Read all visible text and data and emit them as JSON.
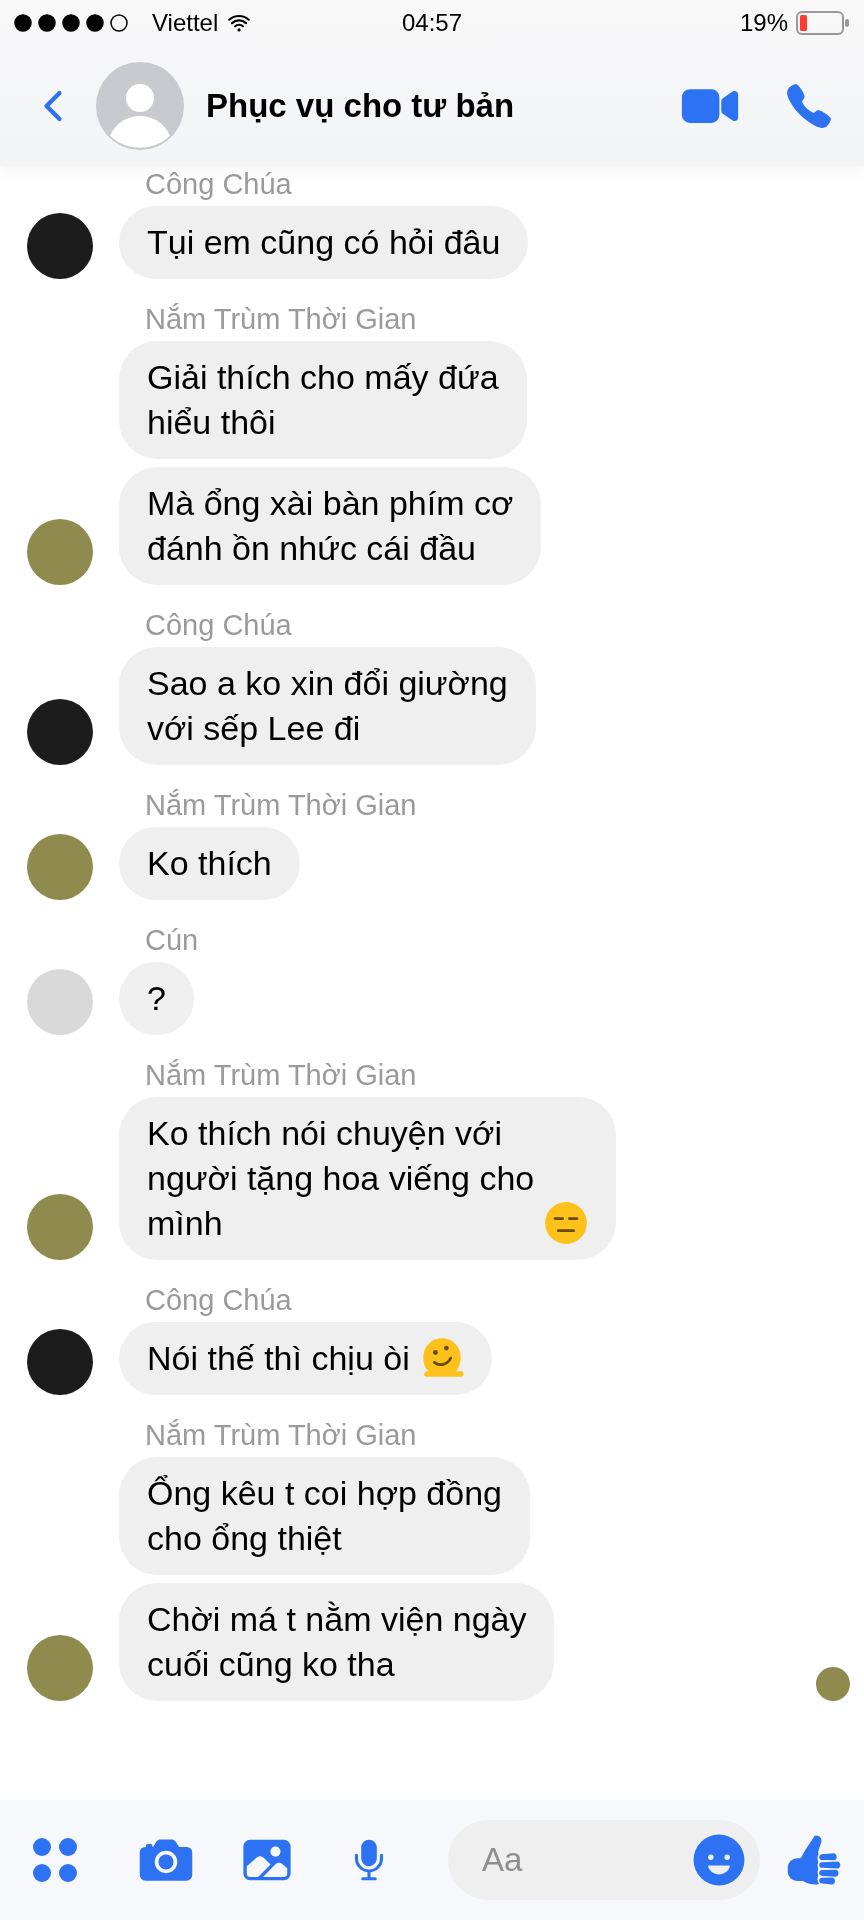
{
  "status_bar": {
    "carrier": "Viettel",
    "time": "04:57",
    "battery": "19%"
  },
  "header": {
    "title": "Phục vụ cho tư bản"
  },
  "groups": [
    {
      "sender": "Công Chúa",
      "color": "#1c1c1c",
      "messages": [
        {
          "kind": "text",
          "text": "Tụi em cũng có hỏi đâu"
        }
      ]
    },
    {
      "sender": "Nắm Trùm Thời Gian",
      "color": "#8f8a4e",
      "messages": [
        {
          "kind": "text",
          "text": "Giải thích cho mấy đứa\nhiểu thôi"
        },
        {
          "kind": "text",
          "text": "Mà ổng xài bàn phím cơ\nđánh ồn nhức cái đầu"
        }
      ]
    },
    {
      "sender": "Công Chúa",
      "color": "#1c1c1c",
      "messages": [
        {
          "kind": "text",
          "text": "Sao a ko xin đổi giường\nvới sếp Lee đi"
        }
      ]
    },
    {
      "sender": "Nắm Trùm Thời Gian",
      "color": "#8f8a4e",
      "messages": [
        {
          "kind": "text",
          "text": "Ko thích"
        }
      ]
    },
    {
      "sender": "Cún",
      "color": "#d9d9d9",
      "messages": [
        {
          "kind": "text",
          "text": "?"
        }
      ]
    },
    {
      "sender": "Nắm Trùm Thời Gian",
      "color": "#8f8a4e",
      "messages": [
        {
          "kind": "expressionless",
          "text": "Ko thích nói chuyện với\nngười tặng hoa viếng cho\nmình"
        }
      ]
    },
    {
      "sender": "Công Chúa",
      "color": "#1c1c1c",
      "messages": [
        {
          "kind": "melting",
          "text": "Nói thế thì chịu òi"
        }
      ]
    },
    {
      "sender": "Nắm Trùm Thời Gian",
      "color": "#8f8a4e",
      "messages": [
        {
          "kind": "text",
          "text": "Ổng kêu t coi hợp đồng\ncho ổng thiệt"
        },
        {
          "kind": "text",
          "text": "Chời má t nằm viện ngày\ncuối cũng ko tha"
        }
      ]
    }
  ],
  "read_receipt": {
    "color": "#8f8a4e"
  },
  "composer": {
    "placeholder": "Aa"
  }
}
